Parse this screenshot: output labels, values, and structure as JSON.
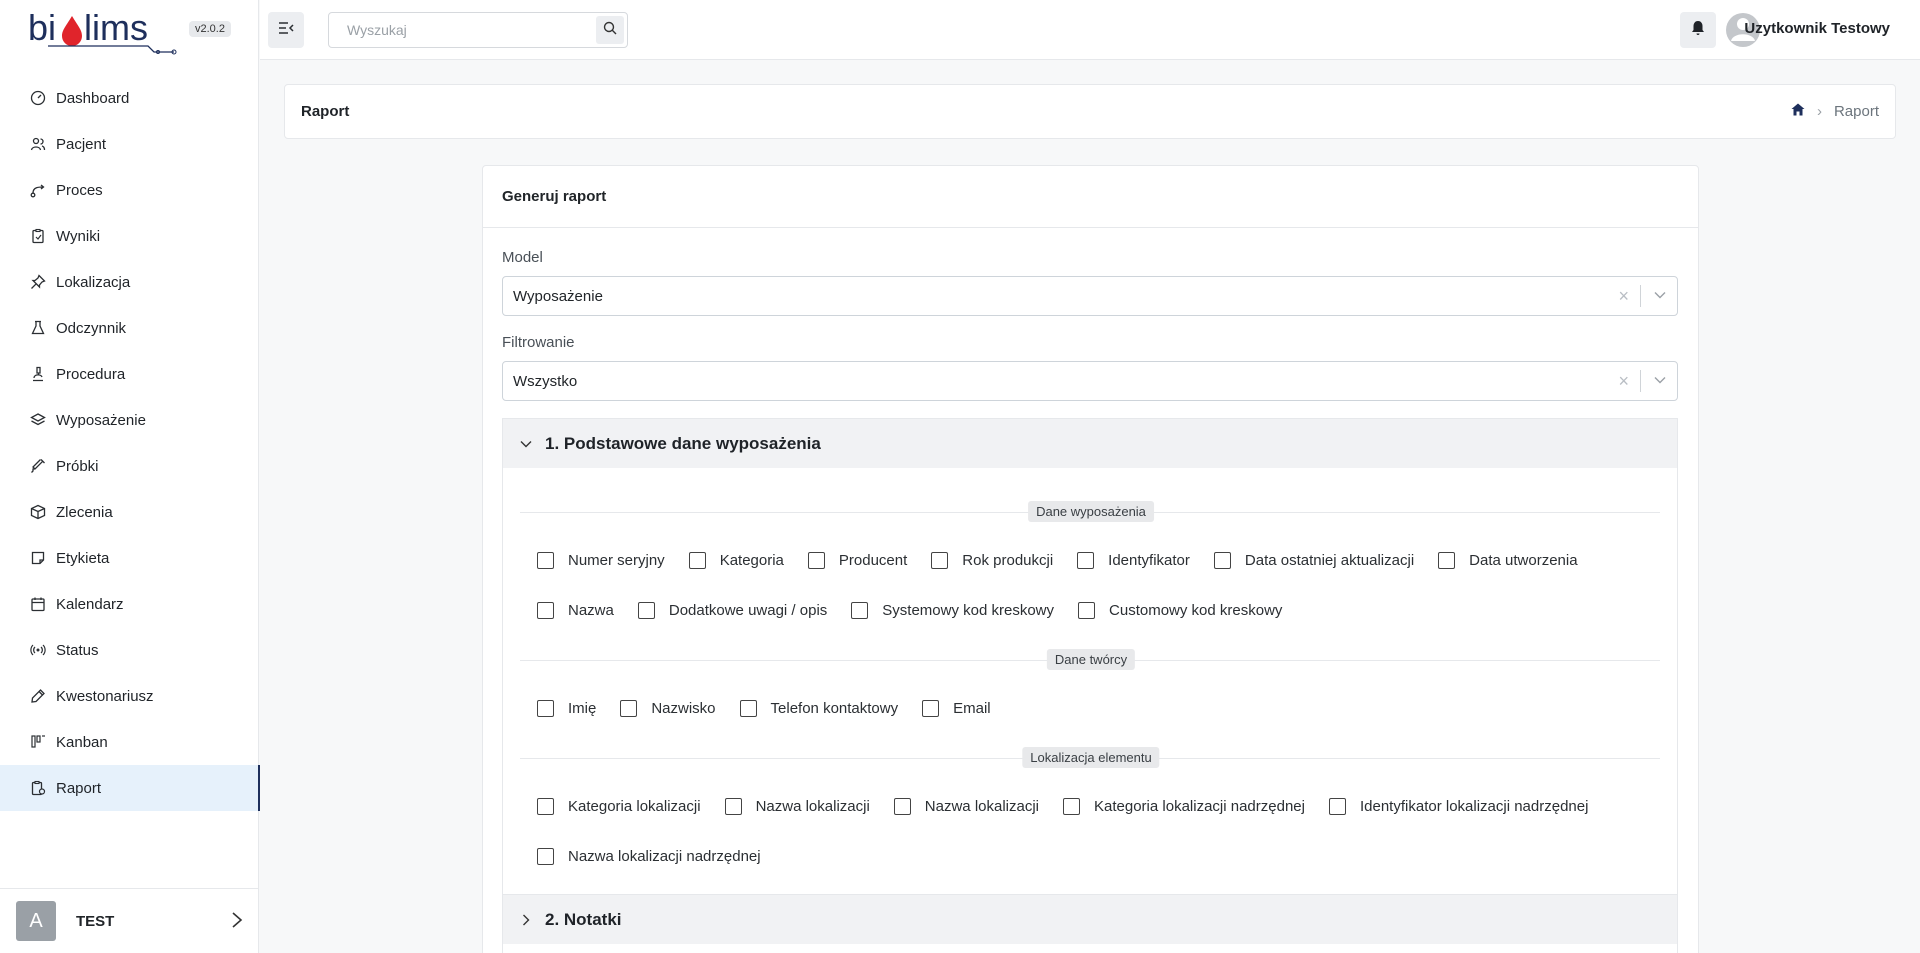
{
  "app": {
    "logo_text": "biolims",
    "version": "v2.0.2"
  },
  "sidebar": {
    "items": [
      {
        "label": "Dashboard",
        "icon": "dashboard-icon"
      },
      {
        "label": "Pacjent",
        "icon": "users-icon"
      },
      {
        "label": "Proces",
        "icon": "process-icon"
      },
      {
        "label": "Wyniki",
        "icon": "clipboard-icon"
      },
      {
        "label": "Lokalizacja",
        "icon": "pin-icon"
      },
      {
        "label": "Odczynnik",
        "icon": "flask-icon"
      },
      {
        "label": "Procedura",
        "icon": "microscope-icon"
      },
      {
        "label": "Wyposażenie",
        "icon": "layers-icon"
      },
      {
        "label": "Próbki",
        "icon": "syringe-icon"
      },
      {
        "label": "Zlecenia",
        "icon": "box-icon"
      },
      {
        "label": "Etykieta",
        "icon": "sticky-note-icon"
      },
      {
        "label": "Kalendarz",
        "icon": "calendar-icon"
      },
      {
        "label": "Status",
        "icon": "broadcast-icon"
      },
      {
        "label": "Kwestonariusz",
        "icon": "pen-icon"
      },
      {
        "label": "Kanban",
        "icon": "kanban-icon"
      },
      {
        "label": "Raport",
        "icon": "report-icon",
        "active": true
      }
    ],
    "footer": {
      "avatar_letter": "A",
      "name": "TEST"
    }
  },
  "topbar": {
    "search_placeholder": "Wyszukaj",
    "user_name": "Uzytkownik Testowy"
  },
  "page": {
    "title": "Raport",
    "breadcrumb_current": "Raport"
  },
  "card": {
    "title": "Generuj raport",
    "model_label": "Model",
    "model_value": "Wyposażenie",
    "filter_label": "Filtrowanie",
    "filter_value": "Wszystko",
    "sections": {
      "s1_title": "1. Podstawowe dane wyposażenia",
      "s2_title": "2. Notatki"
    },
    "groups": {
      "g1": "Dane wyposażenia",
      "g2": "Dane twórcy",
      "g3": "Lokalizacja elementu"
    },
    "row1": [
      "Numer seryjny",
      "Kategoria",
      "Producent",
      "Rok produkcji",
      "Identyfikator",
      "Data ostatniej aktualizacji",
      "Data utworzenia"
    ],
    "row2": [
      "Nazwa",
      "Dodatkowe uwagi / opis",
      "Systemowy kod kreskowy",
      "Customowy kod kreskowy"
    ],
    "row3": [
      "Imię",
      "Nazwisko",
      "Telefon kontaktowy",
      "Email"
    ],
    "row4": [
      "Kategoria lokalizacji",
      "Nazwa lokalizacji",
      "Nazwa lokalizacji",
      "Kategoria lokalizacji nadrzędnej",
      "Identyfikator lokalizacji nadrzędnej"
    ],
    "row5": [
      "Nazwa lokalizacji nadrzędnej"
    ]
  },
  "colors": {
    "brand": "#1e2f5c",
    "active_bg": "#e6f1fb",
    "logo_drop": "#e0242b"
  }
}
